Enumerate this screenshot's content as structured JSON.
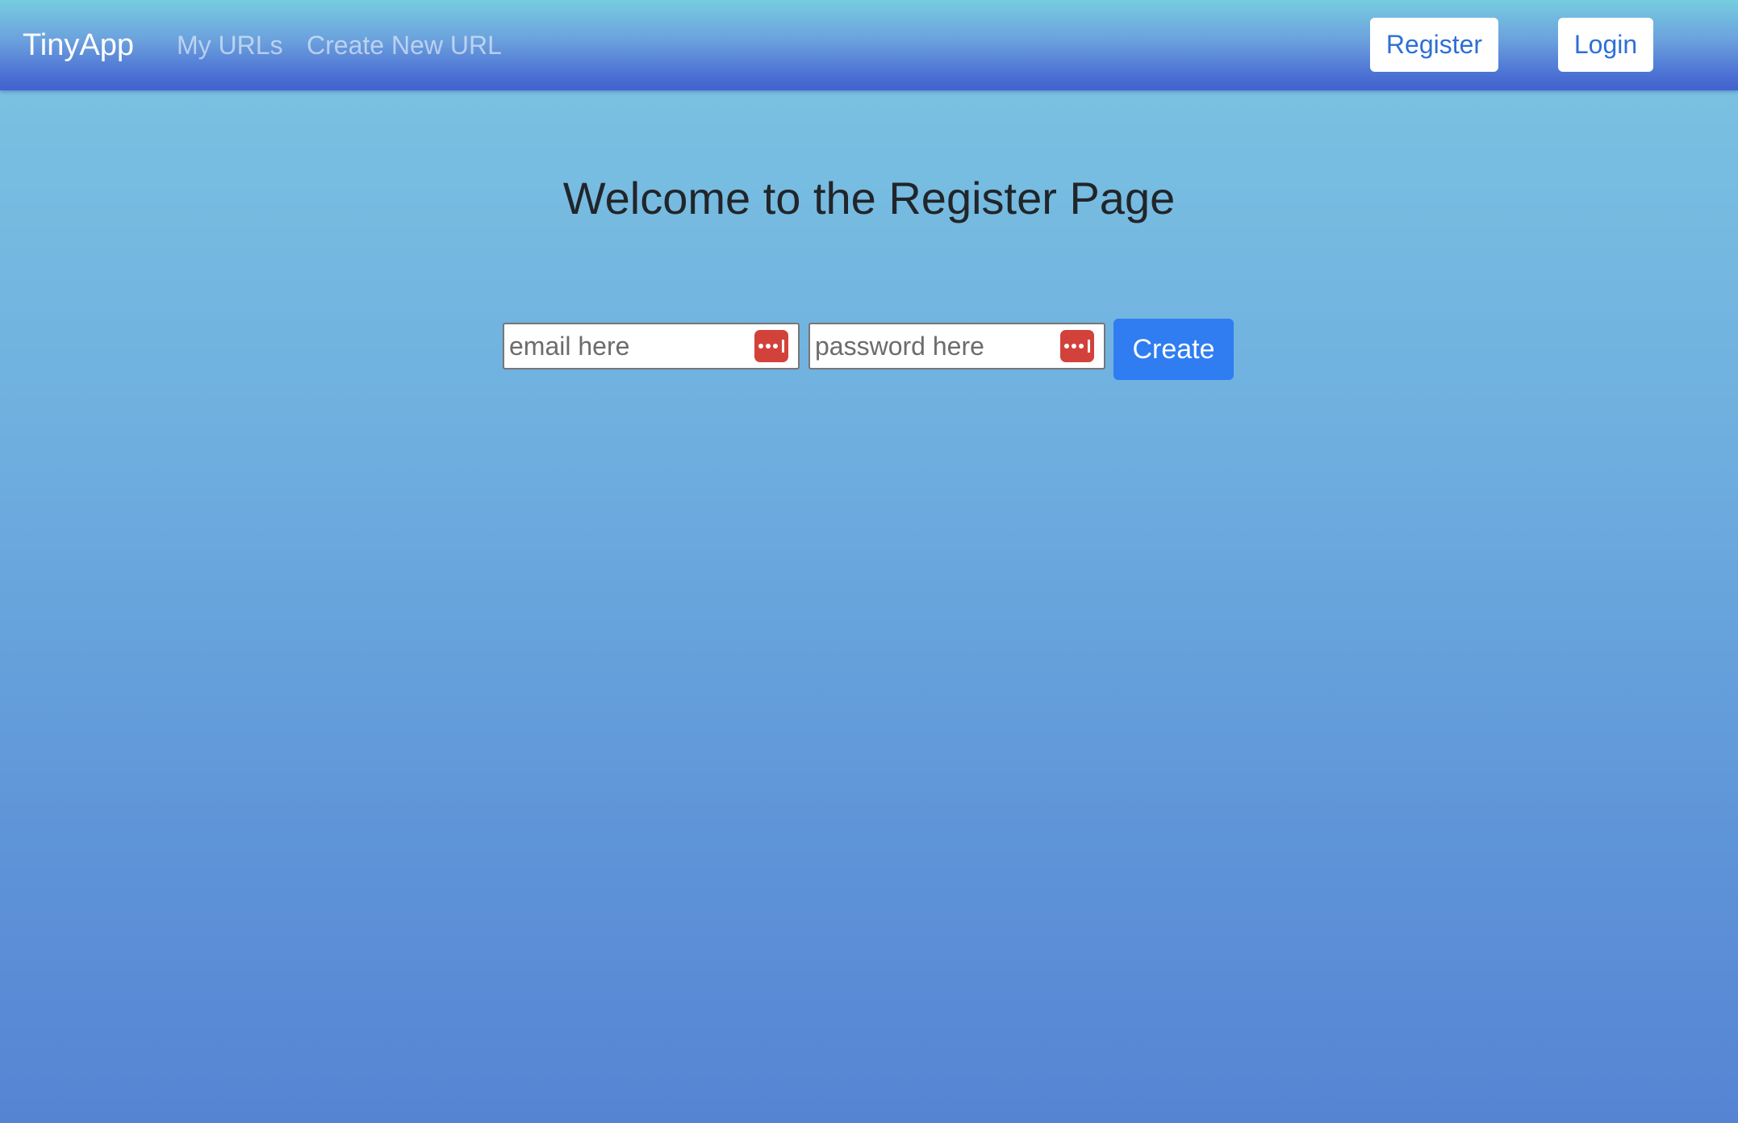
{
  "navbar": {
    "brand": "TinyApp",
    "links": [
      "My URLs",
      "Create New URL"
    ],
    "register_label": "Register",
    "login_label": "Login"
  },
  "main": {
    "title": "Welcome to the Register Page",
    "email_placeholder": "email here",
    "password_placeholder": "password here",
    "create_label": "Create"
  },
  "icons": {
    "password_manager": "password-manager-icon"
  },
  "colors": {
    "primary_button": "#2f7df1",
    "register_login_text": "#2f6fd6",
    "password_manager_icon": "#d2423a",
    "title_text": "#212529"
  }
}
